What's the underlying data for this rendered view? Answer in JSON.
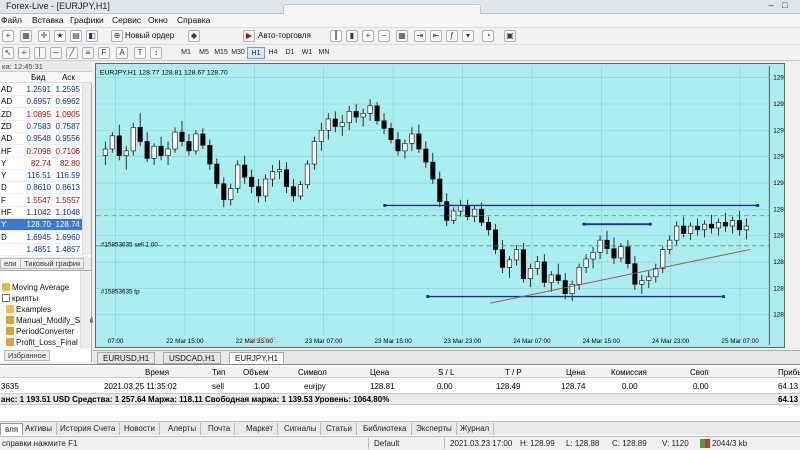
{
  "app": {
    "title": "Forex-Live - [EURJPY,H1]"
  },
  "menu": [
    "Файл",
    "Вставка",
    "Графики",
    "Сервис",
    "Окно",
    "Справка"
  ],
  "toolbar": {
    "new_order": "Новый ордер",
    "auto_trading": "Авто-торговля"
  },
  "timeframes": [
    {
      "label": "M1",
      "active": false
    },
    {
      "label": "M5",
      "active": false
    },
    {
      "label": "M15",
      "active": false
    },
    {
      "label": "M30",
      "active": false
    },
    {
      "label": "H1",
      "active": true
    },
    {
      "label": "H4",
      "active": false
    },
    {
      "label": "D1",
      "active": false
    },
    {
      "label": "W1",
      "active": false
    },
    {
      "label": "MN",
      "active": false
    }
  ],
  "market_watch": {
    "header": "ка: 12:45:31",
    "col_bid": "Бид",
    "col_ask": "Аск",
    "rows": [
      {
        "sym": "AD",
        "bid": "1.2591",
        "ask": "1.2595",
        "dir": "up"
      },
      {
        "sym": "AD",
        "bid": "0.6957",
        "ask": "0.6962",
        "dir": "up"
      },
      {
        "sym": "ZD",
        "bid": "1.0895",
        "ask": "1.0905",
        "dir": "dn"
      },
      {
        "sym": "ZD",
        "bid": "0.7583",
        "ask": "0.7587",
        "dir": "up"
      },
      {
        "sym": "AD",
        "bid": "0.9548",
        "ask": "0.9556",
        "dir": "up"
      },
      {
        "sym": "HF",
        "bid": "0.7098",
        "ask": "0.7106",
        "dir": "dn"
      },
      {
        "sym": "Y",
        "bid": "82.74",
        "ask": "82.80",
        "dir": "dn"
      },
      {
        "sym": "Y",
        "bid": "116.51",
        "ask": "116.59",
        "dir": "up"
      },
      {
        "sym": "D",
        "bid": "0.8610",
        "ask": "0.8613",
        "dir": "up"
      },
      {
        "sym": "F",
        "bid": "1.5547",
        "ask": "1.5557",
        "dir": "dn"
      },
      {
        "sym": "HF",
        "bid": "1.1042",
        "ask": "1.1048",
        "dir": "up"
      },
      {
        "sym": "Y",
        "bid": "128.70",
        "ask": "128.74",
        "dir": "up",
        "selected": true
      },
      {
        "sym": "D",
        "bid": "1.6945",
        "ask": "1.6960",
        "dir": "up"
      },
      {
        "sym": "",
        "bid": "1.4851",
        "ask": "1.4857",
        "dir": "up"
      }
    ],
    "tab_symbols": "ели",
    "tab_tick": "Тиковый график"
  },
  "navigator": {
    "items": [
      "Moving Average",
      "крипты",
      "Examples",
      "Manual_Modify_Stopl",
      "PeriodConverter",
      "Profit_Loss_Final"
    ],
    "tab_favorites": "Избранное"
  },
  "chart": {
    "header": "EURJPY,H1  128.77 128.81 128.67 128.70",
    "sell_label": "#15853635 sell 1.00",
    "tp_label": "#15853635 tp",
    "watermark": "USDCHF,...",
    "x_labels": [
      "07:00",
      "22 Mar 15:00",
      "22 Mar 23:00",
      "23 Mar 07:00",
      "23 Mar 15:00",
      "23 Mar 23:00",
      "24 Mar 07:00",
      "24 Mar 15:00",
      "24 Mar 23:00",
      "25 Mar 07:00"
    ],
    "y_labels": [
      "129",
      "129",
      "129",
      "129",
      "129",
      "128",
      "128",
      "128",
      "128",
      "128"
    ]
  },
  "chart_data": {
    "type": "candlestick",
    "title": "EURJPY,H1  128.77 128.81 128.67 128.70",
    "xlabel": "",
    "ylabel": "",
    "x_ticks": [
      "07:00",
      "22 Mar 15:00",
      "22 Mar 23:00",
      "23 Mar 07:00",
      "23 Mar 15:00",
      "23 Mar 23:00",
      "24 Mar 07:00",
      "24 Mar 15:00",
      "24 Mar 23:00",
      "25 Mar 07:00"
    ],
    "ylim": [
      127.6,
      130.3
    ],
    "candles": [
      [
        129.45,
        129.6,
        129.35,
        129.52
      ],
      [
        129.52,
        129.7,
        129.48,
        129.66
      ],
      [
        129.66,
        129.78,
        129.4,
        129.45
      ],
      [
        129.45,
        129.55,
        129.3,
        129.5
      ],
      [
        129.5,
        129.8,
        129.45,
        129.75
      ],
      [
        129.75,
        129.9,
        129.55,
        129.6
      ],
      [
        129.6,
        129.7,
        129.38,
        129.42
      ],
      [
        129.42,
        129.58,
        129.35,
        129.55
      ],
      [
        129.55,
        129.65,
        129.4,
        129.45
      ],
      [
        129.45,
        129.6,
        129.35,
        129.52
      ],
      [
        129.52,
        129.75,
        129.48,
        129.7
      ],
      [
        129.7,
        129.82,
        129.55,
        129.6
      ],
      [
        129.6,
        129.68,
        129.45,
        129.5
      ],
      [
        129.5,
        129.72,
        129.46,
        129.68
      ],
      [
        129.68,
        129.74,
        129.52,
        129.56
      ],
      [
        129.56,
        129.62,
        129.3,
        129.36
      ],
      [
        129.36,
        129.42,
        129.1,
        129.15
      ],
      [
        129.15,
        129.22,
        128.9,
        128.98
      ],
      [
        128.98,
        129.15,
        128.92,
        129.1
      ],
      [
        129.1,
        129.4,
        129.05,
        129.35
      ],
      [
        129.35,
        129.45,
        129.15,
        129.22
      ],
      [
        129.22,
        129.3,
        129.05,
        129.12
      ],
      [
        129.12,
        129.2,
        128.95,
        129.02
      ],
      [
        129.02,
        129.25,
        128.96,
        129.2
      ],
      [
        129.2,
        129.35,
        129.12,
        129.28
      ],
      [
        129.28,
        129.4,
        129.2,
        129.3
      ],
      [
        129.3,
        129.38,
        129.05,
        129.12
      ],
      [
        129.12,
        129.2,
        128.96,
        129.02
      ],
      [
        129.02,
        129.18,
        128.98,
        129.14
      ],
      [
        129.14,
        129.4,
        129.1,
        129.36
      ],
      [
        129.36,
        129.65,
        129.3,
        129.6
      ],
      [
        129.6,
        129.8,
        129.5,
        129.72
      ],
      [
        129.72,
        129.9,
        129.62,
        129.84
      ],
      [
        129.84,
        129.92,
        129.7,
        129.76
      ],
      [
        129.76,
        129.88,
        129.66,
        129.8
      ],
      [
        129.8,
        129.98,
        129.72,
        129.92
      ],
      [
        129.92,
        130.0,
        129.8,
        129.86
      ],
      [
        129.86,
        129.95,
        129.76,
        129.9
      ],
      [
        129.9,
        130.05,
        129.82,
        129.98
      ],
      [
        129.98,
        130.02,
        129.78,
        129.82
      ],
      [
        129.82,
        129.9,
        129.68,
        129.74
      ],
      [
        129.74,
        129.8,
        129.58,
        129.62
      ],
      [
        129.62,
        129.7,
        129.45,
        129.5
      ],
      [
        129.5,
        129.62,
        129.42,
        129.58
      ],
      [
        129.58,
        129.75,
        129.5,
        129.68
      ],
      [
        129.68,
        129.78,
        129.48,
        129.52
      ],
      [
        129.52,
        129.6,
        129.32,
        129.38
      ],
      [
        129.38,
        129.48,
        129.15,
        129.2
      ],
      [
        129.2,
        129.28,
        128.9,
        128.96
      ],
      [
        128.96,
        129.05,
        128.7,
        128.76
      ],
      [
        128.76,
        128.9,
        128.72,
        128.86
      ],
      [
        128.86,
        128.98,
        128.8,
        128.92
      ],
      [
        128.92,
        128.98,
        128.76,
        128.8
      ],
      [
        128.8,
        128.92,
        128.74,
        128.88
      ],
      [
        128.88,
        128.95,
        128.7,
        128.74
      ],
      [
        128.74,
        128.8,
        128.6,
        128.66
      ],
      [
        128.66,
        128.72,
        128.4,
        128.45
      ],
      [
        128.45,
        128.55,
        128.2,
        128.26
      ],
      [
        128.26,
        128.38,
        128.15,
        128.34
      ],
      [
        128.34,
        128.5,
        128.28,
        128.45
      ],
      [
        128.45,
        128.52,
        128.1,
        128.14
      ],
      [
        128.14,
        128.3,
        128.05,
        128.25
      ],
      [
        128.25,
        128.38,
        128.18,
        128.32
      ],
      [
        128.32,
        128.4,
        128.05,
        128.1
      ],
      [
        128.1,
        128.22,
        128.0,
        128.18
      ],
      [
        128.18,
        128.3,
        128.08,
        128.12
      ],
      [
        128.12,
        128.2,
        127.92,
        127.98
      ],
      [
        127.98,
        128.12,
        127.9,
        128.08
      ],
      [
        128.08,
        128.3,
        128.02,
        128.26
      ],
      [
        128.26,
        128.4,
        128.2,
        128.35
      ],
      [
        128.35,
        128.48,
        128.25,
        128.42
      ],
      [
        128.42,
        128.6,
        128.35,
        128.55
      ],
      [
        128.55,
        128.65,
        128.4,
        128.46
      ],
      [
        128.46,
        128.58,
        128.3,
        128.36
      ],
      [
        128.36,
        128.52,
        128.32,
        128.48
      ],
      [
        128.48,
        128.55,
        128.25,
        128.3
      ],
      [
        128.3,
        128.38,
        128.02,
        128.08
      ],
      [
        128.08,
        128.18,
        127.98,
        128.12
      ],
      [
        128.12,
        128.22,
        128.04,
        128.16
      ],
      [
        128.16,
        128.3,
        128.1,
        128.25
      ],
      [
        128.25,
        128.48,
        128.2,
        128.45
      ],
      [
        128.45,
        128.6,
        128.4,
        128.55
      ],
      [
        128.55,
        128.75,
        128.5,
        128.7
      ],
      [
        128.7,
        128.8,
        128.58,
        128.62
      ],
      [
        128.62,
        128.74,
        128.55,
        128.7
      ],
      [
        128.7,
        128.78,
        128.6,
        128.66
      ],
      [
        128.66,
        128.76,
        128.58,
        128.72
      ],
      [
        128.72,
        128.82,
        128.62,
        128.68
      ],
      [
        128.68,
        128.78,
        128.6,
        128.74
      ],
      [
        128.74,
        128.84,
        128.64,
        128.7
      ],
      [
        128.7,
        128.8,
        128.62,
        128.76
      ],
      [
        128.76,
        128.86,
        128.6,
        128.66
      ],
      [
        128.66,
        128.78,
        128.56,
        128.7
      ]
    ],
    "levels": [
      {
        "name": "#15853635 sell 1.00",
        "value": 128.81
      },
      {
        "name": "#15853635 tp",
        "value": 128.49
      }
    ]
  },
  "chart_tabs": [
    {
      "label": "EURUSD,H1",
      "active": false
    },
    {
      "label": "USDCAD,H1",
      "active": false
    },
    {
      "label": "EURJPY,H1",
      "active": true
    }
  ],
  "terminal": {
    "cols": [
      "Время",
      "Тип",
      "Объем",
      "Символ",
      "Цена",
      "S / L",
      "T / P",
      "Цена",
      "Комиссия",
      "Своп",
      "Прибы"
    ],
    "row": [
      "3635",
      "2021.03.25 11:35:02",
      "sell",
      "1.00",
      "eurjpy",
      "128.81",
      "0.00",
      "128.49",
      "128.74",
      "0.00",
      "0.00",
      "64.13"
    ],
    "balance": "анс: 1 193.51 USD  Средства: 1 257.64  Маржа: 118.11  Свободная маржа: 1 139.53  Уровень: 1064.80%",
    "balance_profit": "64.13"
  },
  "terminal_tabs": [
    {
      "label": "вля",
      "active": true
    },
    {
      "label": "Активы",
      "active": false
    },
    {
      "label": "История Счета",
      "active": false
    },
    {
      "label": "Новости",
      "active": false
    },
    {
      "label": "Алерты",
      "active": false
    },
    {
      "label": "Почта",
      "active": false
    },
    {
      "label": "Маркет",
      "active": false
    },
    {
      "label": "Сигналы",
      "active": false
    },
    {
      "label": "Статьи",
      "active": false
    },
    {
      "label": "Библиотека",
      "active": false
    },
    {
      "label": "Эксперты",
      "active": false
    },
    {
      "label": "Журнал",
      "active": false
    }
  ],
  "status": {
    "help": "справки нажмите F1",
    "profile": "Default",
    "datetime": "2021.03.23 17:00",
    "h": "H: 128.99",
    "l": "L: 128.88",
    "c": "C: 128.89",
    "v": "V: 1120",
    "traffic": "2044/3 kb"
  },
  "colors": {
    "chart_bg": "#aaeef0",
    "bull": "#ffffff",
    "bear": "#000000",
    "level": "#1f2aa8",
    "trend": "#b0504a"
  }
}
